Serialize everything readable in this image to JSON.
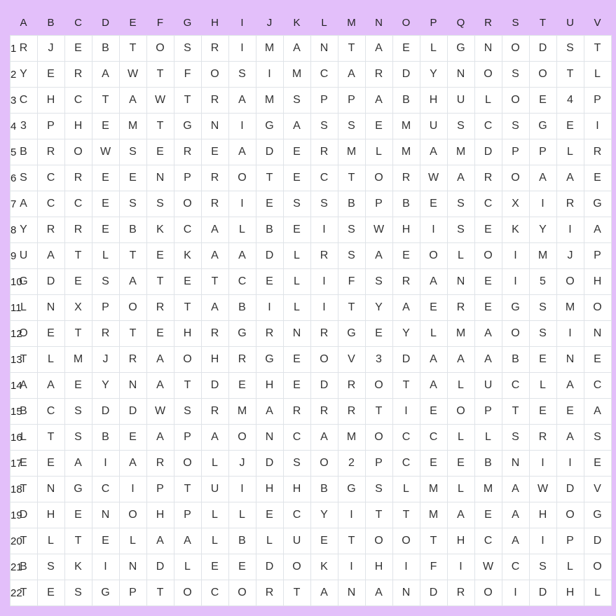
{
  "grid": {
    "columns": [
      "A",
      "B",
      "C",
      "D",
      "E",
      "F",
      "G",
      "H",
      "I",
      "J",
      "K",
      "L",
      "M",
      "N",
      "O",
      "P",
      "Q",
      "R",
      "S",
      "T",
      "U",
      "V"
    ],
    "rowLabels": [
      "1",
      "2",
      "3",
      "4",
      "5",
      "6",
      "7",
      "8",
      "9",
      "10",
      "11",
      "12",
      "13",
      "14",
      "15",
      "16",
      "17",
      "18",
      "19",
      "20",
      "21",
      "22"
    ],
    "rows": [
      [
        "R",
        "J",
        "E",
        "B",
        "T",
        "O",
        "S",
        "R",
        "I",
        "M",
        "A",
        "N",
        "T",
        "A",
        "E",
        "L",
        "G",
        "N",
        "O",
        "D",
        "S",
        "T"
      ],
      [
        "Y",
        "E",
        "R",
        "A",
        "W",
        "T",
        "F",
        "O",
        "S",
        "I",
        "M",
        "C",
        "A",
        "R",
        "D",
        "Y",
        "N",
        "O",
        "S",
        "O",
        "T",
        "L"
      ],
      [
        "C",
        "H",
        "C",
        "T",
        "A",
        "W",
        "T",
        "R",
        "A",
        "M",
        "S",
        "P",
        "P",
        "A",
        "B",
        "H",
        "U",
        "L",
        "O",
        "E",
        "4",
        "P"
      ],
      [
        "3",
        "P",
        "H",
        "E",
        "M",
        "T",
        "G",
        "N",
        "I",
        "G",
        "A",
        "S",
        "S",
        "E",
        "M",
        "U",
        "S",
        "C",
        "S",
        "G",
        "E",
        "I"
      ],
      [
        "B",
        "R",
        "O",
        "W",
        "S",
        "E",
        "R",
        "E",
        "A",
        "D",
        "E",
        "R",
        "M",
        "L",
        "M",
        "A",
        "M",
        "D",
        "P",
        "P",
        "L",
        "R"
      ],
      [
        "S",
        "C",
        "R",
        "E",
        "E",
        "N",
        "P",
        "R",
        "O",
        "T",
        "E",
        "C",
        "T",
        "O",
        "R",
        "W",
        "A",
        "R",
        "O",
        "A",
        "A",
        "E"
      ],
      [
        "A",
        "C",
        "C",
        "E",
        "S",
        "S",
        "O",
        "R",
        "I",
        "E",
        "S",
        "S",
        "B",
        "P",
        "B",
        "E",
        "S",
        "C",
        "X",
        "I",
        "R",
        "G"
      ],
      [
        "Y",
        "R",
        "R",
        "E",
        "B",
        "K",
        "C",
        "A",
        "L",
        "B",
        "E",
        "I",
        "S",
        "W",
        "H",
        "I",
        "S",
        "E",
        "K",
        "Y",
        "I",
        "A"
      ],
      [
        "U",
        "A",
        "T",
        "L",
        "T",
        "E",
        "K",
        "A",
        "A",
        "D",
        "L",
        "R",
        "S",
        "A",
        "E",
        "O",
        "L",
        "O",
        "I",
        "M",
        "J",
        "P"
      ],
      [
        "G",
        "D",
        "E",
        "S",
        "A",
        "T",
        "E",
        "T",
        "C",
        "E",
        "L",
        "I",
        "F",
        "S",
        "R",
        "A",
        "N",
        "E",
        "I",
        "5",
        "O",
        "H"
      ],
      [
        "L",
        "N",
        "X",
        "P",
        "O",
        "R",
        "T",
        "A",
        "B",
        "I",
        "L",
        "I",
        "T",
        "Y",
        "A",
        "E",
        "R",
        "E",
        "G",
        "S",
        "M",
        "O"
      ],
      [
        "O",
        "E",
        "T",
        "R",
        "T",
        "E",
        "H",
        "R",
        "G",
        "R",
        "N",
        "R",
        "G",
        "E",
        "Y",
        "L",
        "M",
        "A",
        "O",
        "S",
        "I",
        "N"
      ],
      [
        "T",
        "L",
        "M",
        "J",
        "R",
        "A",
        "O",
        "H",
        "R",
        "G",
        "E",
        "O",
        "V",
        "3",
        "D",
        "A",
        "A",
        "A",
        "B",
        "E",
        "N",
        "E"
      ],
      [
        "A",
        "A",
        "E",
        "Y",
        "N",
        "A",
        "T",
        "D",
        "E",
        "H",
        "E",
        "D",
        "R",
        "O",
        "T",
        "A",
        "L",
        "U",
        "C",
        "L",
        "A",
        "C"
      ],
      [
        "B",
        "C",
        "S",
        "D",
        "D",
        "W",
        "S",
        "R",
        "M",
        "A",
        "R",
        "R",
        "R",
        "T",
        "I",
        "E",
        "O",
        "P",
        "T",
        "E",
        "E",
        "A"
      ],
      [
        "L",
        "T",
        "S",
        "B",
        "E",
        "A",
        "P",
        "A",
        "O",
        "N",
        "C",
        "A",
        "M",
        "O",
        "C",
        "C",
        "L",
        "L",
        "S",
        "R",
        "A",
        "S"
      ],
      [
        "E",
        "E",
        "A",
        "I",
        "A",
        "R",
        "O",
        "L",
        "J",
        "D",
        "S",
        "O",
        "2",
        "P",
        "C",
        "E",
        "E",
        "B",
        "N",
        "I",
        "I",
        "E"
      ],
      [
        "T",
        "N",
        "G",
        "C",
        "I",
        "P",
        "T",
        "U",
        "I",
        "H",
        "H",
        "B",
        "G",
        "S",
        "L",
        "M",
        "L",
        "M",
        "A",
        "W",
        "D",
        "V"
      ],
      [
        "D",
        "H",
        "E",
        "N",
        "O",
        "H",
        "P",
        "L",
        "L",
        "E",
        "C",
        "Y",
        "I",
        "T",
        "T",
        "M",
        "A",
        "E",
        "A",
        "H",
        "O",
        "G"
      ],
      [
        "T",
        "L",
        "T",
        "E",
        "L",
        "A",
        "A",
        "L",
        "B",
        "L",
        "U",
        "E",
        "T",
        "O",
        "O",
        "T",
        "H",
        "C",
        "A",
        "I",
        "P",
        "D"
      ],
      [
        "B",
        "S",
        "K",
        "I",
        "N",
        "D",
        "L",
        "E",
        "E",
        "D",
        "O",
        "K",
        "I",
        "H",
        "I",
        "F",
        "I",
        "W",
        "C",
        "S",
        "L",
        "O"
      ],
      [
        "T",
        "E",
        "S",
        "G",
        "P",
        "T",
        "O",
        "C",
        "O",
        "R",
        "T",
        "A",
        "N",
        "A",
        "N",
        "D",
        "R",
        "O",
        "I",
        "D",
        "H",
        "L"
      ]
    ]
  }
}
